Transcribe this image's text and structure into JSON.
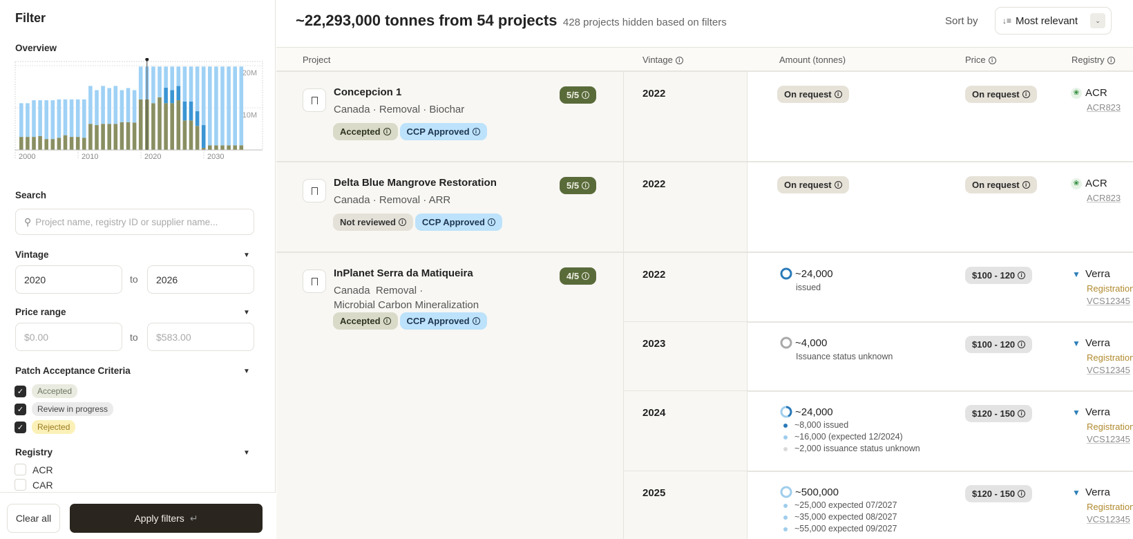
{
  "sidebar": {
    "title": "Filter",
    "overview_label": "Overview",
    "search": {
      "label": "Search",
      "placeholder": "Project name, registry ID or supplier name..."
    },
    "vintage": {
      "label": "Vintage",
      "from": "2020",
      "to_label": "to",
      "to": "2026"
    },
    "price": {
      "label": "Price range",
      "from_placeholder": "$0.00",
      "to_label": "to",
      "to_placeholder": "$583.00"
    },
    "criteria": {
      "label": "Patch Acceptance Criteria",
      "items": [
        {
          "label": "Accepted",
          "checked": true,
          "color": "#e9ebe0",
          "text_color": "#6b7560"
        },
        {
          "label": "Review in progress",
          "checked": true,
          "color": "#ebebeb",
          "text_color": "#444"
        },
        {
          "label": "Rejected",
          "checked": true,
          "color": "#fbf1b8",
          "text_color": "#9a7a1e"
        }
      ]
    },
    "registry": {
      "label": "Registry",
      "items": [
        {
          "label": "ACR",
          "checked": false
        },
        {
          "label": "CAR",
          "checked": false
        }
      ]
    },
    "clear_label": "Clear all",
    "apply_label": "Apply filters",
    "apply_icon": "enter-key-icon"
  },
  "chart_data": {
    "type": "bar",
    "stacked": true,
    "categories": [
      2000,
      2001,
      2002,
      2003,
      2004,
      2005,
      2006,
      2007,
      2008,
      2009,
      2010,
      2011,
      2012,
      2013,
      2014,
      2015,
      2016,
      2017,
      2018,
      2019,
      2020,
      2021,
      2022,
      2023,
      2024,
      2025,
      2026,
      2027,
      2028,
      2029,
      2030,
      2031,
      2032,
      2033,
      2034,
      2035
    ],
    "x_tick_labels": [
      "2000",
      "2010",
      "2020",
      "2030"
    ],
    "y_tick_labels": [
      "10M",
      "20M"
    ],
    "y_ticks": [
      10,
      20
    ],
    "ylim": [
      0,
      21
    ],
    "y_unit": "million tonnes",
    "grid": true,
    "marker_year": 2020,
    "series": [
      {
        "color": "#8a8f62",
        "values": [
          3.1,
          3.1,
          3.1,
          3.3,
          2.6,
          2.6,
          2.9,
          3.5,
          3.1,
          3.1,
          2.9,
          6.2,
          5.9,
          6.2,
          6.2,
          6.2,
          6.6,
          6.6,
          6.5,
          12.0,
          12.0,
          11.1,
          12.5,
          11.1,
          11.1,
          11.8,
          7.0,
          7.0,
          5.7,
          0.5,
          1.1,
          1.1,
          1.1,
          1.1,
          1.1,
          1.1
        ]
      },
      {
        "color": "#3b95d3",
        "values": [
          0,
          0,
          0,
          0,
          0,
          0,
          0,
          0,
          0,
          0,
          0,
          0,
          0,
          0,
          0,
          0,
          0,
          0,
          0,
          0,
          0,
          0,
          0,
          3.7,
          3.1,
          3.4,
          4.5,
          4.5,
          3.5,
          5.4,
          0,
          0,
          0,
          0,
          0,
          0
        ]
      },
      {
        "color": "#9fd1f5",
        "values": [
          8.0,
          8.0,
          8.7,
          8.5,
          9.2,
          9.2,
          9.1,
          8.5,
          8.9,
          8.9,
          9.1,
          9.0,
          8.3,
          9.0,
          8.5,
          9.0,
          7.6,
          8.1,
          7.7,
          7.8,
          7.8,
          8.7,
          7.3,
          5.0,
          5.6,
          4.6,
          8.3,
          8.3,
          10.6,
          13.9,
          18.7,
          18.7,
          18.7,
          18.7,
          18.7,
          18.7
        ]
      }
    ]
  },
  "header": {
    "title": "~22,293,000 tonnes from 54 projects",
    "subtitle": "428 projects hidden based on filters",
    "sort_label": "Sort by",
    "sort_value": "Most relevant"
  },
  "columns": [
    "Project",
    "Vintage",
    "Amount (tonnes)",
    "Price",
    "Registry"
  ],
  "projects": [
    {
      "name": "Concepcion 1",
      "meta": "Canada · Removal · Biochar",
      "score": "5/5",
      "tags": [
        {
          "label": "Accepted",
          "kind": "accepted"
        },
        {
          "label": "CCP Approved",
          "kind": "ccp"
        }
      ],
      "vintages": [
        {
          "year": "2022",
          "amount": "On request",
          "amount_pill": true,
          "price": "On request",
          "price_kind": "request",
          "registry": "ACR",
          "registry_id": "ACR823"
        }
      ]
    },
    {
      "name": "Delta Blue Mangrove Restoration",
      "meta": "Canada · Removal · ARR",
      "score": "5/5",
      "tags": [
        {
          "label": "Not reviewed",
          "kind": "notreviewed"
        },
        {
          "label": "CCP Approved",
          "kind": "ccp"
        }
      ],
      "vintages": [
        {
          "year": "2022",
          "amount": "On request",
          "amount_pill": true,
          "price": "On request",
          "price_kind": "request",
          "registry": "ACR",
          "registry_id": "ACR823"
        }
      ]
    },
    {
      "name": "InPlanet Serra da Matiqueira",
      "meta": "Canada  Removal ·",
      "meta2": "Microbial Carbon Mineralization",
      "score": "4/5",
      "tags": [
        {
          "label": "Accepted",
          "kind": "accepted"
        },
        {
          "label": "CCP Approved",
          "kind": "ccp"
        }
      ],
      "vintages": [
        {
          "year": "2022",
          "amount": "~24,000",
          "status": "issued",
          "ring": "issued",
          "price": "$100 - 120",
          "registry": "Verra",
          "registry_status": "Registration",
          "registry_id": "VCS12345"
        },
        {
          "year": "2023",
          "amount": "~4,000",
          "status": "Issuance status unknown",
          "ring": "unknown",
          "price": "$100 - 120",
          "registry": "Verra",
          "registry_status": "Registration",
          "registry_id": "VCS12345"
        },
        {
          "year": "2024",
          "amount": "~24,000",
          "ring": "partial",
          "breakdown": [
            {
              "text": "~8,000 issued",
              "color": "#2a7ab8"
            },
            {
              "text": "~16,000 (expected 12/2024)",
              "color": "#9fcdec"
            },
            {
              "text": "~2,000 issuance status unknown",
              "color": "#d9d9d9"
            }
          ],
          "price": "$120 - 150",
          "registry": "Verra",
          "registry_status": "Registration",
          "registry_id": "VCS12345"
        },
        {
          "year": "2025",
          "amount": "~500,000",
          "ring": "expected",
          "breakdown": [
            {
              "text": "~25,000 expected 07/2027",
              "color": "#9fcdec"
            },
            {
              "text": "~35,000 expected 08/2027",
              "color": "#9fcdec"
            },
            {
              "text": "~55,000 expected 09/2027",
              "color": "#9fcdec"
            }
          ],
          "price": "$120 - 150",
          "registry": "Verra",
          "registry_status": "Registration",
          "registry_id": "VCS12345"
        }
      ]
    }
  ]
}
